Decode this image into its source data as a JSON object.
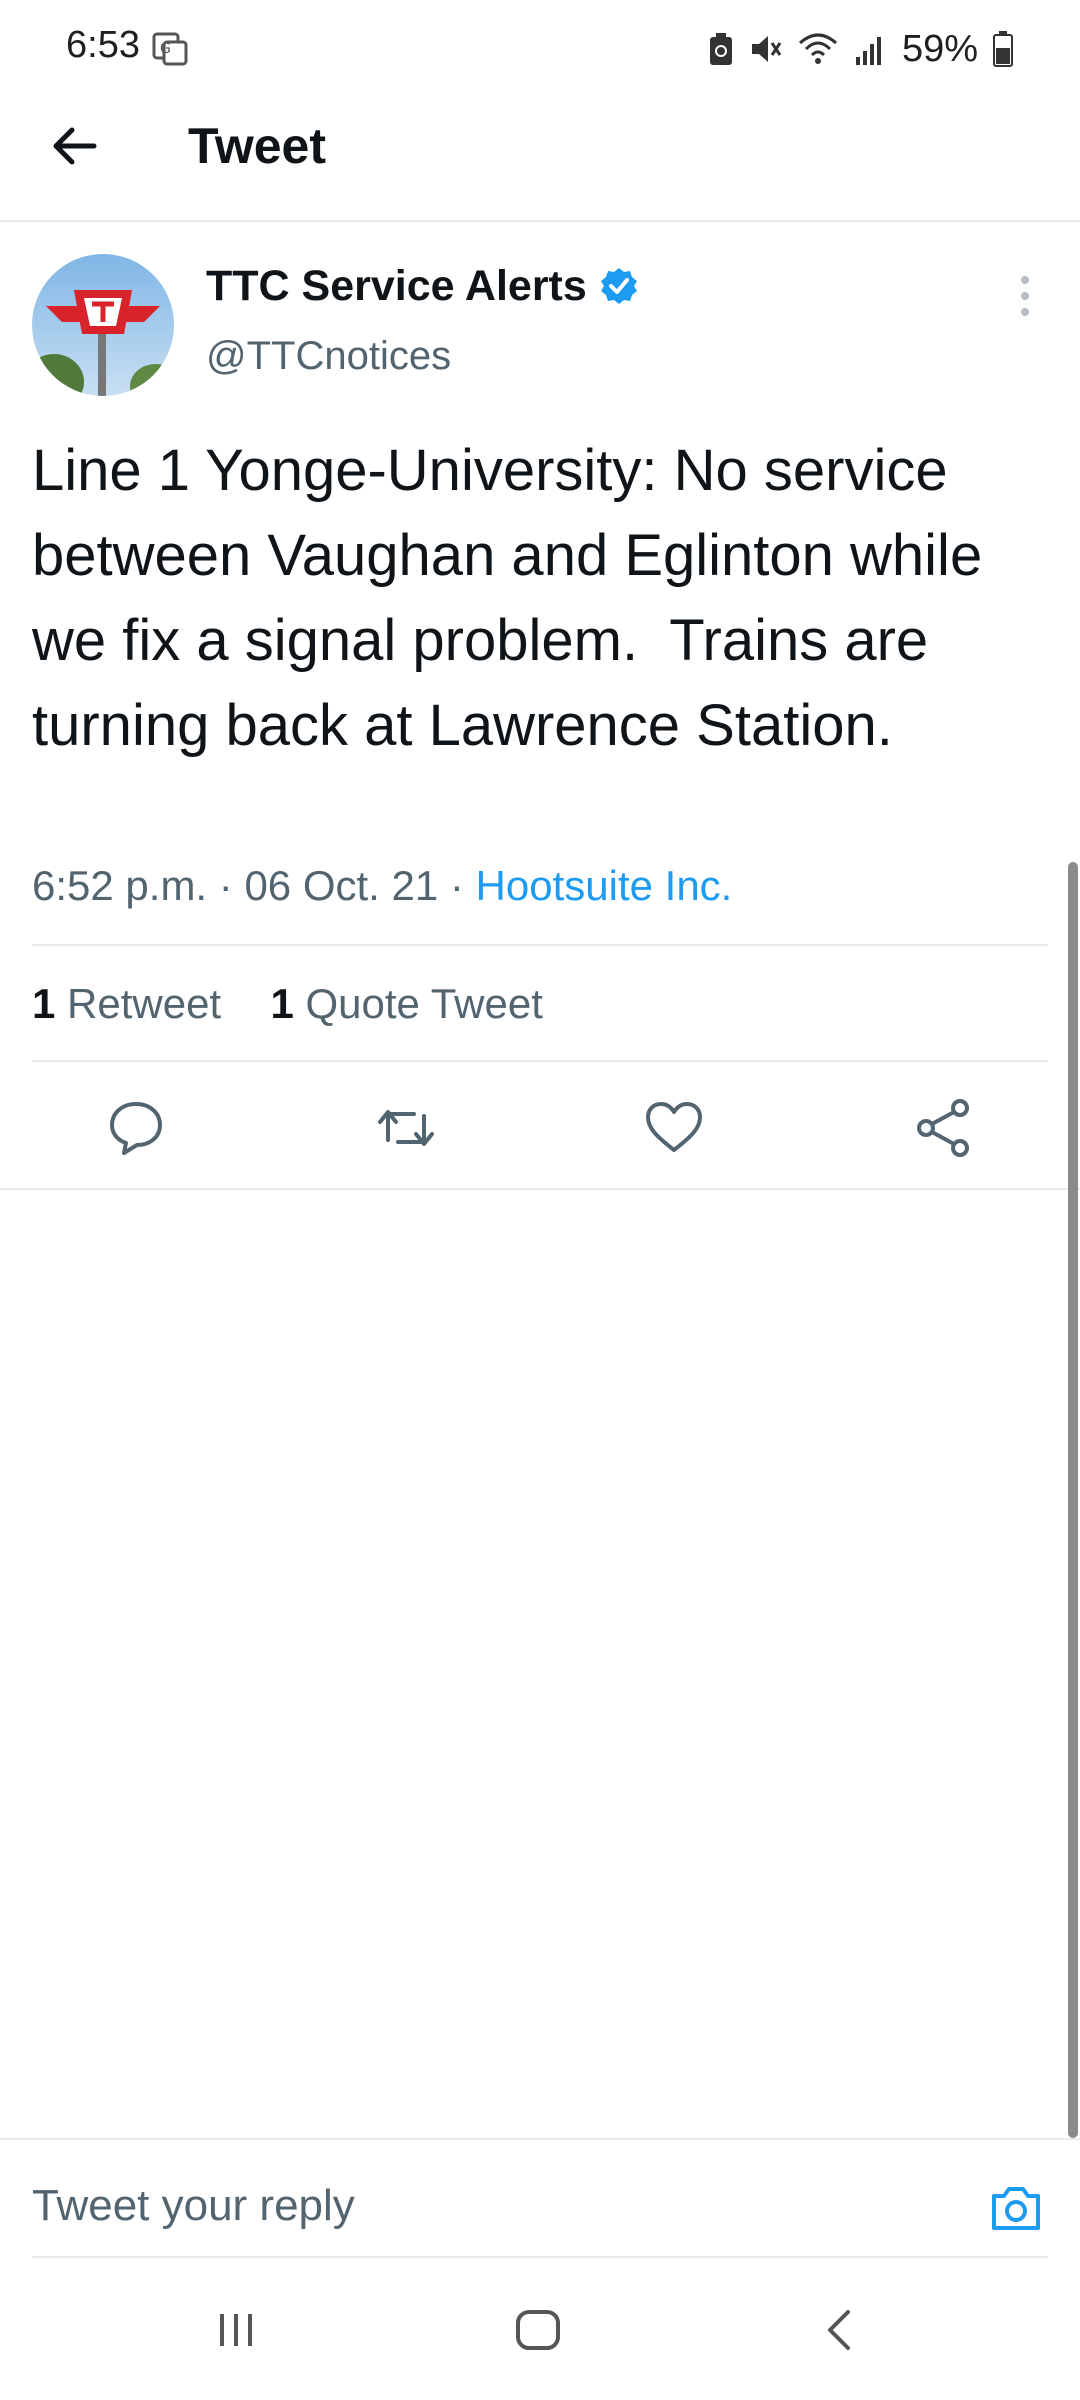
{
  "status_bar": {
    "time": "6:53",
    "battery": "59%"
  },
  "header": {
    "title": "Tweet"
  },
  "tweet": {
    "author_name": "TTC Service Alerts",
    "handle": "@TTCnotices",
    "text": "Line 1 Yonge-University: No service between Vaughan and Eglinton while we fix a signal problem.  Trains are turning back at Lawrence Station.",
    "time": "6:52 p.m.",
    "date": "06 Oct. 21",
    "source": "Hootsuite Inc.",
    "retweets_count": "1",
    "retweets_label": "Retweet",
    "quotes_count": "1",
    "quotes_label": "Quote Tweet"
  },
  "reply": {
    "placeholder": "Tweet your reply"
  },
  "colors": {
    "accent": "#1d9bf0",
    "muted": "#536471",
    "text": "#0f1419",
    "divider": "#e6ecf0"
  }
}
